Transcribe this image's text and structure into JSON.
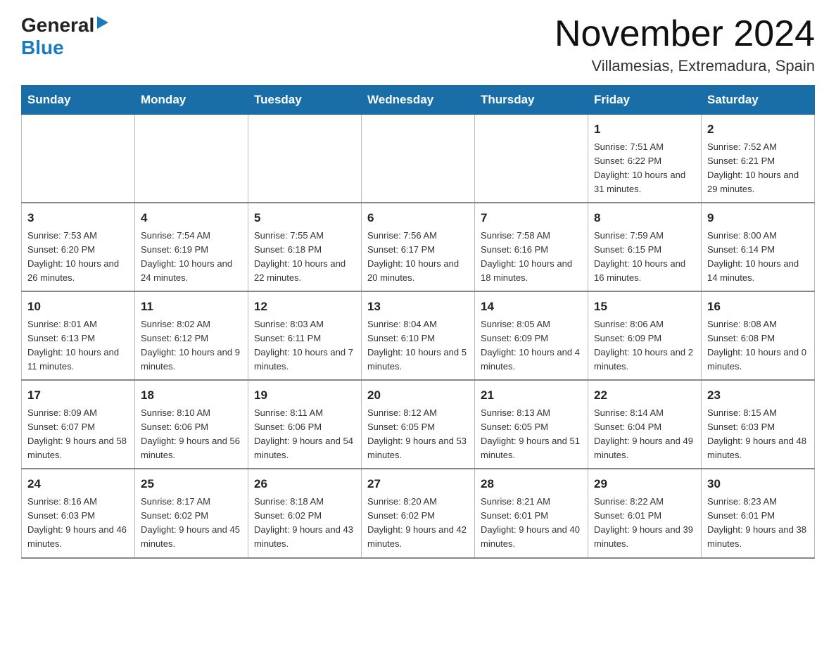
{
  "header": {
    "logo_general": "General",
    "logo_blue": "Blue",
    "title": "November 2024",
    "subtitle": "Villamesias, Extremadura, Spain"
  },
  "calendar": {
    "days_of_week": [
      "Sunday",
      "Monday",
      "Tuesday",
      "Wednesday",
      "Thursday",
      "Friday",
      "Saturday"
    ],
    "weeks": [
      [
        {
          "day": "",
          "info": ""
        },
        {
          "day": "",
          "info": ""
        },
        {
          "day": "",
          "info": ""
        },
        {
          "day": "",
          "info": ""
        },
        {
          "day": "",
          "info": ""
        },
        {
          "day": "1",
          "info": "Sunrise: 7:51 AM\nSunset: 6:22 PM\nDaylight: 10 hours and 31 minutes."
        },
        {
          "day": "2",
          "info": "Sunrise: 7:52 AM\nSunset: 6:21 PM\nDaylight: 10 hours and 29 minutes."
        }
      ],
      [
        {
          "day": "3",
          "info": "Sunrise: 7:53 AM\nSunset: 6:20 PM\nDaylight: 10 hours and 26 minutes."
        },
        {
          "day": "4",
          "info": "Sunrise: 7:54 AM\nSunset: 6:19 PM\nDaylight: 10 hours and 24 minutes."
        },
        {
          "day": "5",
          "info": "Sunrise: 7:55 AM\nSunset: 6:18 PM\nDaylight: 10 hours and 22 minutes."
        },
        {
          "day": "6",
          "info": "Sunrise: 7:56 AM\nSunset: 6:17 PM\nDaylight: 10 hours and 20 minutes."
        },
        {
          "day": "7",
          "info": "Sunrise: 7:58 AM\nSunset: 6:16 PM\nDaylight: 10 hours and 18 minutes."
        },
        {
          "day": "8",
          "info": "Sunrise: 7:59 AM\nSunset: 6:15 PM\nDaylight: 10 hours and 16 minutes."
        },
        {
          "day": "9",
          "info": "Sunrise: 8:00 AM\nSunset: 6:14 PM\nDaylight: 10 hours and 14 minutes."
        }
      ],
      [
        {
          "day": "10",
          "info": "Sunrise: 8:01 AM\nSunset: 6:13 PM\nDaylight: 10 hours and 11 minutes."
        },
        {
          "day": "11",
          "info": "Sunrise: 8:02 AM\nSunset: 6:12 PM\nDaylight: 10 hours and 9 minutes."
        },
        {
          "day": "12",
          "info": "Sunrise: 8:03 AM\nSunset: 6:11 PM\nDaylight: 10 hours and 7 minutes."
        },
        {
          "day": "13",
          "info": "Sunrise: 8:04 AM\nSunset: 6:10 PM\nDaylight: 10 hours and 5 minutes."
        },
        {
          "day": "14",
          "info": "Sunrise: 8:05 AM\nSunset: 6:09 PM\nDaylight: 10 hours and 4 minutes."
        },
        {
          "day": "15",
          "info": "Sunrise: 8:06 AM\nSunset: 6:09 PM\nDaylight: 10 hours and 2 minutes."
        },
        {
          "day": "16",
          "info": "Sunrise: 8:08 AM\nSunset: 6:08 PM\nDaylight: 10 hours and 0 minutes."
        }
      ],
      [
        {
          "day": "17",
          "info": "Sunrise: 8:09 AM\nSunset: 6:07 PM\nDaylight: 9 hours and 58 minutes."
        },
        {
          "day": "18",
          "info": "Sunrise: 8:10 AM\nSunset: 6:06 PM\nDaylight: 9 hours and 56 minutes."
        },
        {
          "day": "19",
          "info": "Sunrise: 8:11 AM\nSunset: 6:06 PM\nDaylight: 9 hours and 54 minutes."
        },
        {
          "day": "20",
          "info": "Sunrise: 8:12 AM\nSunset: 6:05 PM\nDaylight: 9 hours and 53 minutes."
        },
        {
          "day": "21",
          "info": "Sunrise: 8:13 AM\nSunset: 6:05 PM\nDaylight: 9 hours and 51 minutes."
        },
        {
          "day": "22",
          "info": "Sunrise: 8:14 AM\nSunset: 6:04 PM\nDaylight: 9 hours and 49 minutes."
        },
        {
          "day": "23",
          "info": "Sunrise: 8:15 AM\nSunset: 6:03 PM\nDaylight: 9 hours and 48 minutes."
        }
      ],
      [
        {
          "day": "24",
          "info": "Sunrise: 8:16 AM\nSunset: 6:03 PM\nDaylight: 9 hours and 46 minutes."
        },
        {
          "day": "25",
          "info": "Sunrise: 8:17 AM\nSunset: 6:02 PM\nDaylight: 9 hours and 45 minutes."
        },
        {
          "day": "26",
          "info": "Sunrise: 8:18 AM\nSunset: 6:02 PM\nDaylight: 9 hours and 43 minutes."
        },
        {
          "day": "27",
          "info": "Sunrise: 8:20 AM\nSunset: 6:02 PM\nDaylight: 9 hours and 42 minutes."
        },
        {
          "day": "28",
          "info": "Sunrise: 8:21 AM\nSunset: 6:01 PM\nDaylight: 9 hours and 40 minutes."
        },
        {
          "day": "29",
          "info": "Sunrise: 8:22 AM\nSunset: 6:01 PM\nDaylight: 9 hours and 39 minutes."
        },
        {
          "day": "30",
          "info": "Sunrise: 8:23 AM\nSunset: 6:01 PM\nDaylight: 9 hours and 38 minutes."
        }
      ]
    ]
  }
}
